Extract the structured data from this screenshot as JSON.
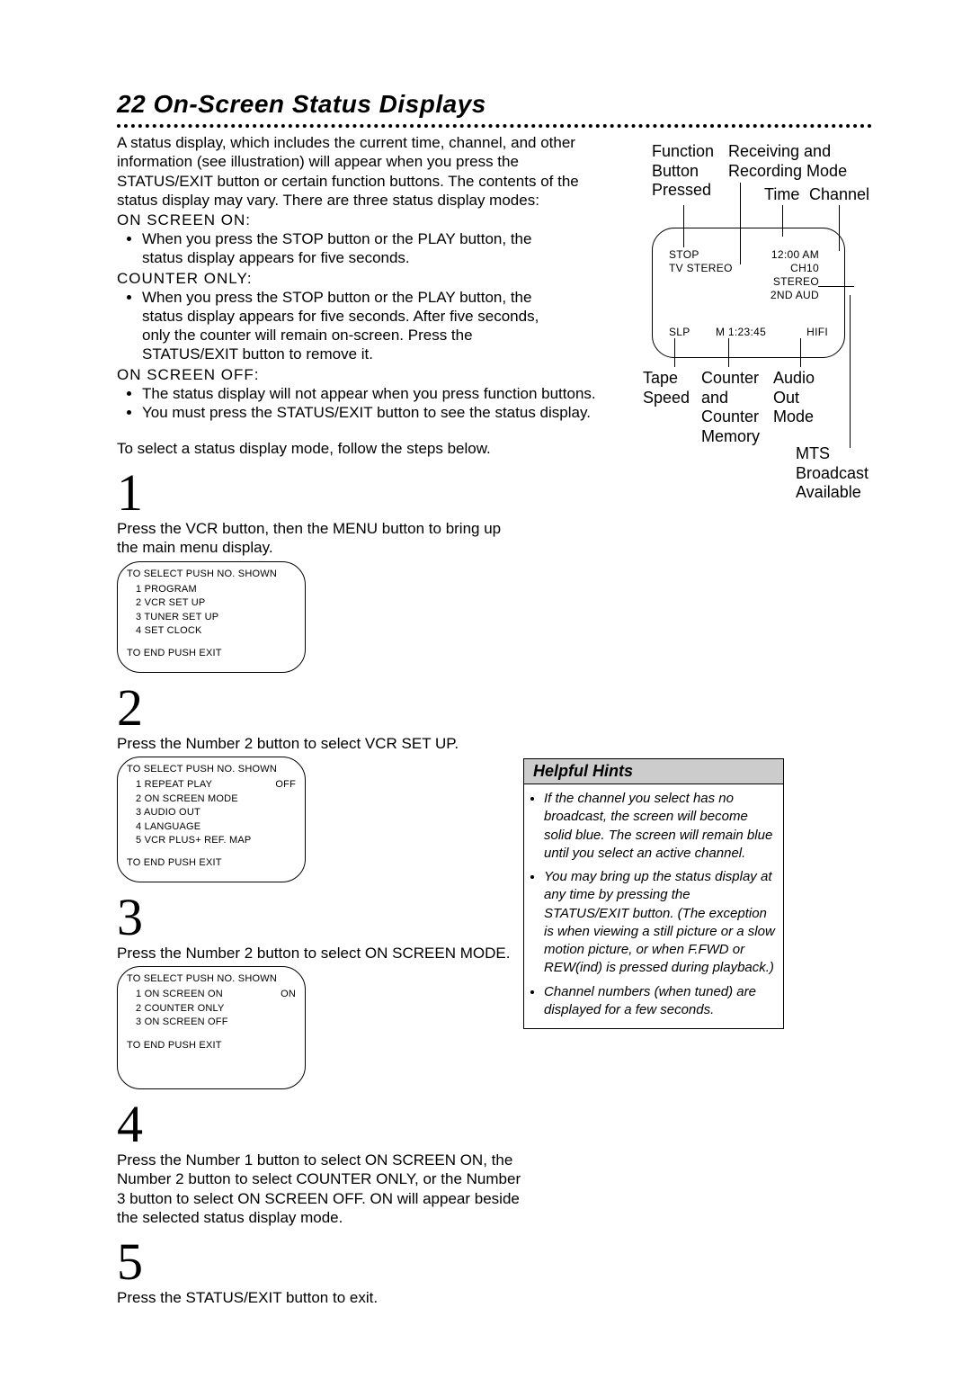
{
  "page_number": "22",
  "title": "On-Screen Status Displays",
  "intro": "A status display, which includes the current time, channel, and other information (see illustration) will appear when you press the STATUS/EXIT button or certain function buttons. The contents of the status display may vary. There are three status display modes:",
  "modes": {
    "on_screen_on": {
      "heading": "ON SCREEN ON:",
      "bullet": "When you press the STOP button or the PLAY button, the status display appears for five seconds."
    },
    "counter_only": {
      "heading": "COUNTER ONLY:",
      "bullet": "When you press the STOP button or the PLAY button, the status display appears for five seconds. After five seconds, only the counter will remain on-screen. Press the STATUS/EXIT button to remove it."
    },
    "on_screen_off": {
      "heading": "ON SCREEN OFF:",
      "bullets": [
        "The status display will not appear when you press function buttons.",
        "You must press the STATUS/EXIT button to see the status display."
      ]
    }
  },
  "select_intro": "To select a status display mode, follow the steps below.",
  "steps": {
    "s1": {
      "num": "1",
      "text": "Press the VCR button, then the MENU button     to bring up the main menu display.",
      "osd": {
        "header": "TO SELECT PUSH NO. SHOWN",
        "items": [
          "1 PROGRAM",
          "2 VCR SET UP",
          "3 TUNER SET UP",
          "4 SET CLOCK"
        ],
        "footer": "TO END PUSH EXIT"
      }
    },
    "s2": {
      "num": "2",
      "text": "Press the Number 2 button     to select VCR SET UP.",
      "osd": {
        "header": "TO SELECT PUSH NO. SHOWN",
        "item1_l": "1 REPEAT PLAY",
        "item1_r": "OFF",
        "items": [
          "2 ON SCREEN MODE",
          "3 AUDIO OUT",
          "4 LANGUAGE",
          "5 VCR PLUS+ REF. MAP"
        ],
        "footer": "TO END PUSH EXIT"
      }
    },
    "s3": {
      "num": "3",
      "text": "Press the Number 2 button     to select ON SCREEN MODE.",
      "osd": {
        "header": "TO SELECT PUSH NO. SHOWN",
        "item1_l": "1 ON SCREEN ON",
        "item1_r": "ON",
        "items": [
          "2 COUNTER ONLY",
          "3 ON SCREEN OFF"
        ],
        "footer": "TO END PUSH EXIT"
      }
    },
    "s4": {
      "num": "4",
      "text": "Press the Number 1 button    to select ON SCREEN ON, the Number 2 button    to select COUNTER ONLY, or the Number 3 button    to select ON SCREEN OFF. ON will appear beside the selected status display mode."
    },
    "s5": {
      "num": "5",
      "text": "Press the STATUS/EXIT button     to exit."
    }
  },
  "annotations": {
    "function_btn": "Function Button Pressed",
    "rec_mode": "Receiving and Recording Mode",
    "time": "Time",
    "channel": "Channel",
    "tape_speed": "Tape Speed",
    "counter": "Counter and Counter Memory",
    "audio_out": "Audio Out Mode",
    "mts": "MTS Broadcast Available"
  },
  "tv": {
    "stop": "STOP",
    "tvstereo": "TV STEREO",
    "time": "12:00 AM",
    "ch": "CH10",
    "stereo": "STEREO",
    "aud": "2ND AUD",
    "slp": "SLP",
    "counter": "M  1:23:45",
    "hifi": "HIFI"
  },
  "hints": {
    "heading": "Helpful Hints",
    "items": [
      "If the channel you select has no broadcast, the screen will become solid blue. The screen will remain blue until you select an active channel.",
      "You may bring up the status display at any time by pressing the STATUS/EXIT button. (The exception is when viewing a still picture or a slow motion picture, or when F.FWD or REW(ind) is pressed during playback.)",
      "Channel numbers (when tuned) are displayed for a few seconds."
    ]
  }
}
